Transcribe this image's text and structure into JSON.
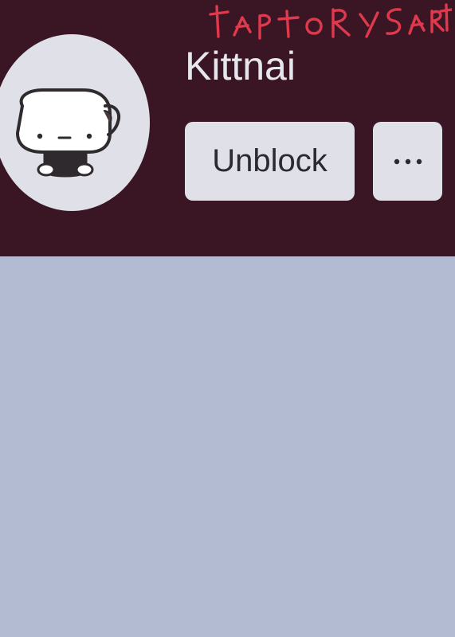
{
  "profile": {
    "name": "Kittnai",
    "avatar_icon": "rice-ball-character-icon"
  },
  "watermark": {
    "text": "taptorysart",
    "color": "#e0384c"
  },
  "actions": {
    "unblock_label": "Unblock",
    "more_icon": "more-horizontal-icon"
  },
  "colors": {
    "header_bg": "#3a1625",
    "body_bg": "#b2bbd1",
    "button_bg": "#dfe0e8",
    "text_light": "#e6e7ec",
    "text_dark": "#2c2a30"
  }
}
